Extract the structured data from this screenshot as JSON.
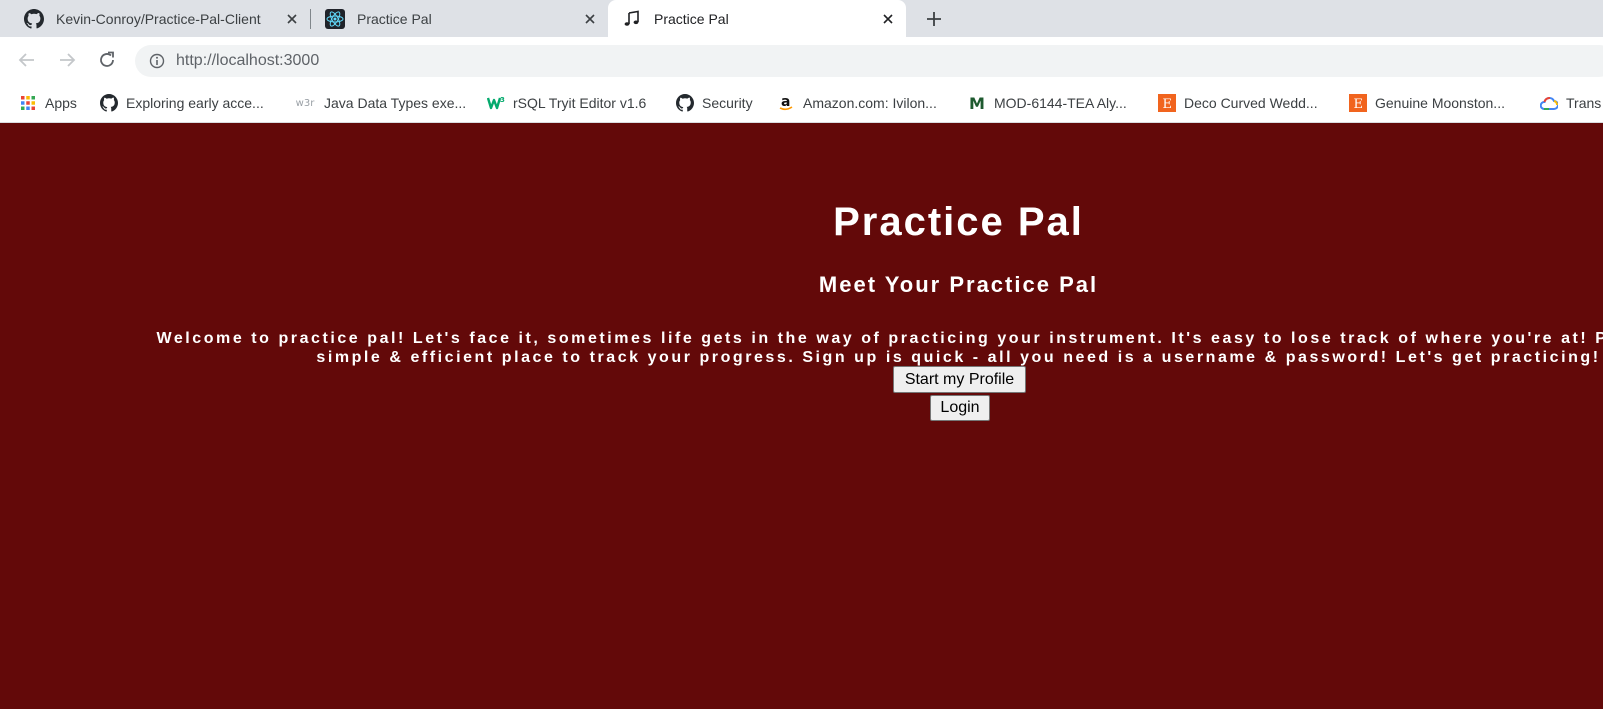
{
  "browser": {
    "tabs": [
      {
        "title": "Kevin-Conroy/Practice-Pal-Client",
        "favicon": "github-icon"
      },
      {
        "title": "Practice Pal",
        "favicon": "react-icon"
      },
      {
        "title": "Practice Pal",
        "favicon": "music-note-icon",
        "active": true
      }
    ],
    "url": "http://localhost:3000",
    "bookmarks": [
      {
        "label": "Apps",
        "icon": "apps-grid-icon"
      },
      {
        "label": "Exploring early acce...",
        "icon": "github-icon"
      },
      {
        "label": "Java Data Types exe...",
        "icon": "w3r-icon"
      },
      {
        "label": "rSQL Tryit Editor v1.6",
        "icon": "w3schools-icon"
      },
      {
        "label": "Security",
        "icon": "github-icon"
      },
      {
        "label": "Amazon.com: Ivilon...",
        "icon": "amazon-icon"
      },
      {
        "label": "MOD-6144-TEA Aly...",
        "icon": "m-logo-icon"
      },
      {
        "label": "Deco Curved Wedd...",
        "icon": "etsy-icon"
      },
      {
        "label": "Genuine Moonston...",
        "icon": "etsy-icon"
      },
      {
        "label": "Trans",
        "icon": "google-cloud-icon"
      }
    ]
  },
  "page": {
    "title": "Practice Pal",
    "subtitle": "Meet Your Practice Pal",
    "welcome_line1": "Welcome to practice pal! Let's face it, sometimes life gets in the way of practicing your instrument. It's easy to lose track of where you're at! Practice Pal is a",
    "welcome_line2": "simple & efficient place to track your progress. Sign up is quick - all you need is a username & password! Let's get practicing!",
    "start_button": "Start my Profile",
    "login_button": "Login"
  },
  "colors": {
    "page_background": "#630909",
    "text": "#ffffff",
    "tabstrip": "#dee1e6"
  }
}
